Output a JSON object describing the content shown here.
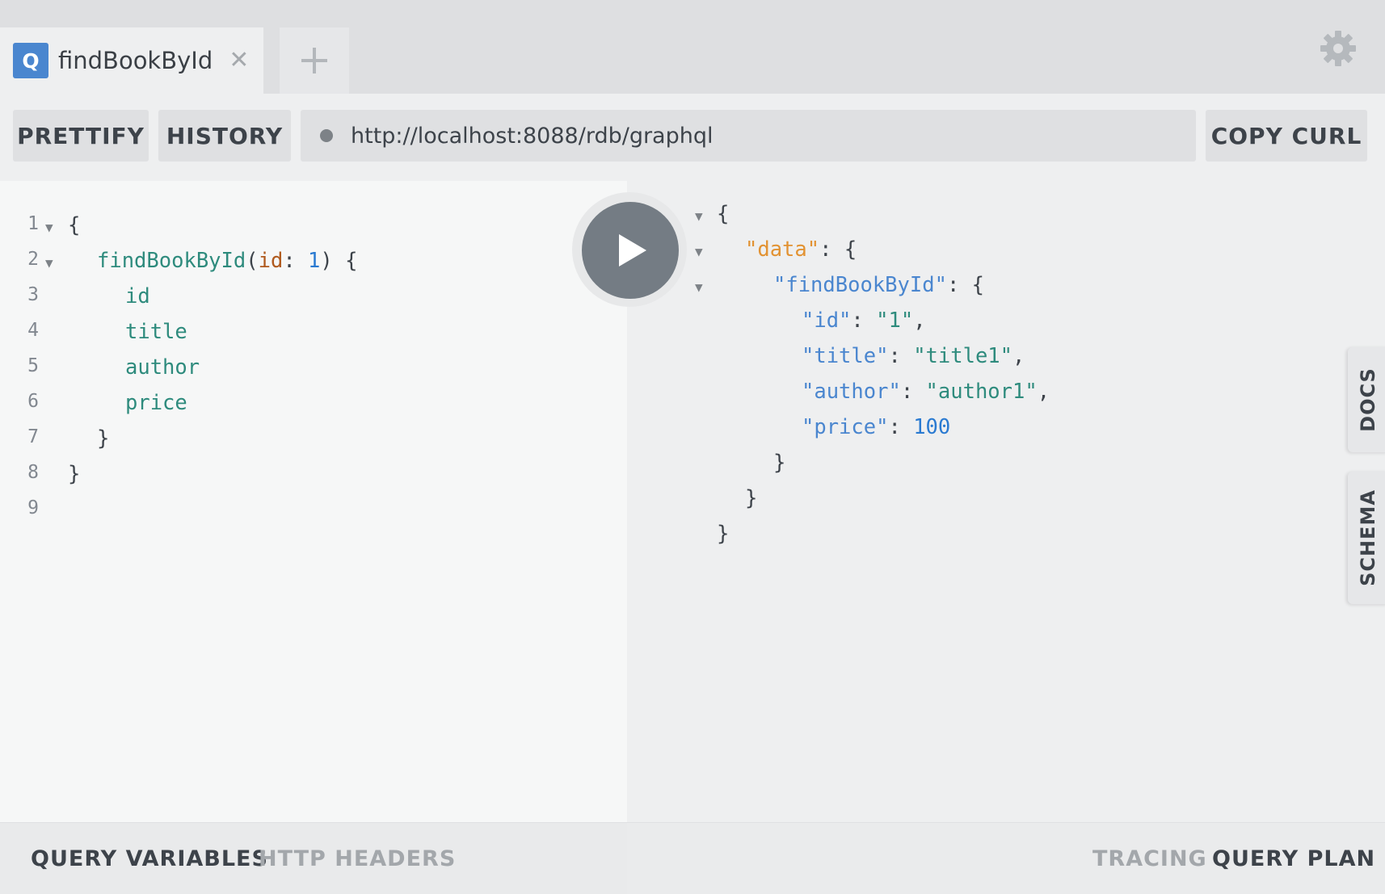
{
  "tabs": {
    "active": {
      "badge": "Q",
      "label": "findBookById",
      "close": "✕"
    },
    "add_label": "+"
  },
  "toolbar": {
    "prettify_label": "PRETTIFY",
    "history_label": "HISTORY",
    "endpoint_url": "http://localhost:8088/rdb/graphql",
    "copy_curl_label": "COPY CURL"
  },
  "editor": {
    "line_numbers": [
      "1",
      "2",
      "3",
      "4",
      "5",
      "6",
      "7",
      "8",
      "9"
    ],
    "line1": {
      "brace": "{"
    },
    "line2": {
      "field": "findBookById",
      "open_paren": "(",
      "arg": "id",
      "colon": ": ",
      "value": "1",
      "close_paren": ")",
      "brace": " {"
    },
    "line3": {
      "field": "id"
    },
    "line4": {
      "field": "title"
    },
    "line5": {
      "field": "author"
    },
    "line6": {
      "field": "price"
    },
    "line7": {
      "brace": "}"
    },
    "line8": {
      "brace": "}"
    }
  },
  "result": {
    "open": "{",
    "data_key": "\"data\"",
    "find_key": "\"findBookById\"",
    "id_key": "\"id\"",
    "id_value": "\"1\"",
    "title_key": "\"title\"",
    "title_value": "\"title1\"",
    "author_key": "\"author\"",
    "author_value": "\"author1\"",
    "price_key": "\"price\"",
    "price_value": "100",
    "colon_brace": ": {",
    "colon": ": ",
    "comma": ",",
    "close": "}"
  },
  "side_tabs": {
    "docs": "DOCS",
    "schema": "SCHEMA"
  },
  "bottom": {
    "query_variables": "QUERY VARIABLES",
    "http_headers": "HTTP HEADERS",
    "tracing": "TRACING",
    "query_plan": "QUERY PLAN"
  },
  "icons": {
    "gear": "gear-icon",
    "play": "play-icon",
    "fold": "fold-arrow-icon",
    "status_dot": "status-dot-icon"
  },
  "colors": {
    "badge_blue": "#4a86cf",
    "run_button": "#747c84",
    "field_teal": "#2e8b7d",
    "json_key_blue": "#4a86cf",
    "json_data_orange": "#e29232",
    "argument_orange": "#b05a1e",
    "number_blue": "#2a7ad1"
  }
}
